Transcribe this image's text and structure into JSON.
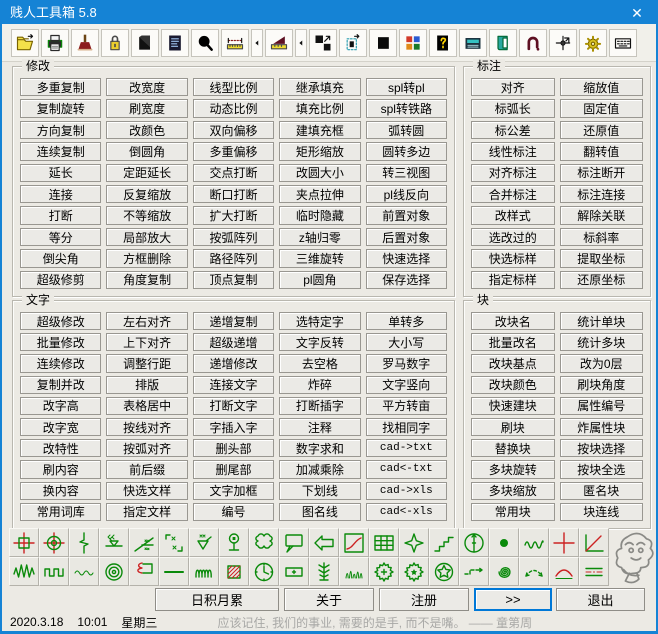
{
  "window": {
    "title": "贱人工具箱 5.8",
    "close_glyph": "✕"
  },
  "colors": {
    "titlebar": "#1583d5",
    "accent": "#0078d7",
    "icon_green": "#0a8a0a",
    "icon_red": "#cc2222"
  },
  "toolbar": {
    "buttons": [
      {
        "name": "open-file",
        "narrow": false
      },
      {
        "name": "printer",
        "narrow": false
      },
      {
        "name": "brush",
        "narrow": false
      },
      {
        "name": "lock",
        "narrow": false
      },
      {
        "name": "pages",
        "narrow": false
      },
      {
        "name": "document-list",
        "narrow": false
      },
      {
        "name": "magnifier",
        "narrow": false
      },
      {
        "name": "ruler",
        "narrow": false
      },
      {
        "name": "flyout-arrow",
        "narrow": true
      },
      {
        "name": "slope-ruler",
        "narrow": false
      },
      {
        "name": "flyout-arrow",
        "narrow": true
      },
      {
        "name": "scale-objects",
        "narrow": false
      },
      {
        "name": "dotted-selection",
        "narrow": false
      },
      {
        "name": "solid-square",
        "narrow": false
      },
      {
        "name": "color-grid",
        "narrow": false
      },
      {
        "name": "help-doc",
        "narrow": false
      },
      {
        "name": "calculator",
        "narrow": false
      },
      {
        "name": "notepad",
        "narrow": false
      },
      {
        "name": "magnet",
        "narrow": false
      },
      {
        "name": "crosshair-move",
        "narrow": false
      },
      {
        "name": "gear",
        "narrow": false
      },
      {
        "name": "keyboard",
        "narrow": false
      }
    ]
  },
  "groups": [
    {
      "id": "modify",
      "label": "修改",
      "columns": [
        [
          "多重复制",
          "复制旋转",
          "方向复制",
          "连续复制",
          "延长",
          "连接",
          "打断",
          "等分",
          "倒尖角",
          "超级修剪"
        ],
        [
          "改宽度",
          "刷宽度",
          "改颜色",
          "倒圆角",
          "定距延长",
          "反复缩放",
          "不等缩放",
          "局部放大",
          "方框删除",
          "角度复制"
        ],
        [
          "线型比例",
          "动态比例",
          "双向偏移",
          "多重偏移",
          "交点打断",
          "断口打断",
          "扩大打断",
          "按弧阵列",
          "路径阵列",
          "顶点复制"
        ],
        [
          "继承填充",
          "填充比例",
          "建填充框",
          "矩形缩放",
          "改圆大小",
          "夹点拉伸",
          "临时隐藏",
          "z轴归零",
          "三维旋转",
          "pl圆角"
        ],
        [
          "spl转pl",
          "spl转铁路",
          "弧转圆",
          "圆转多边",
          "转三视图",
          "pl线反向",
          "前置对象",
          "后置对象",
          "快速选择",
          "保存选择"
        ]
      ]
    },
    {
      "id": "dimension",
      "label": "标注",
      "columns": [
        [
          "对齐",
          "标弧长",
          "标公差",
          "线性标注",
          "对齐标注",
          "合并标注",
          "改样式",
          "选改过的",
          "快选标样",
          "指定标样"
        ],
        [
          "缩放值",
          "固定值",
          "还原值",
          "翻转值",
          "标注断开",
          "标注连接",
          "解除关联",
          "标斜率",
          "提取坐标",
          "还原坐标"
        ]
      ]
    },
    {
      "id": "text",
      "label": "文字",
      "columns": [
        [
          "超级修改",
          "批量修改",
          "连续修改",
          "复制并改",
          "改字高",
          "改字宽",
          "改特性",
          "刷内容",
          "换内容",
          "常用词库"
        ],
        [
          "左右对齐",
          "上下对齐",
          "调整行距",
          "排版",
          "表格居中",
          "按线对齐",
          "按弧对齐",
          "前后缀",
          "快选文样",
          "指定文样"
        ],
        [
          "递增复制",
          "超级递增",
          "递增修改",
          "连接文字",
          "打断文字",
          "字插入字",
          "删头部",
          "删尾部",
          "文字加框",
          "编号"
        ],
        [
          "选特定字",
          "文字反转",
          "去空格",
          "炸碎",
          "打断插字",
          "注释",
          "数字求和",
          "加减乘除",
          "下划线",
          "图名线"
        ],
        [
          "单转多",
          "大小写",
          "罗马数字",
          "文字竖向",
          "平方转亩",
          "找相同字",
          "cad->txt",
          "cad<-txt",
          "cad->xls",
          "cad<-xls"
        ]
      ]
    },
    {
      "id": "block",
      "label": "块",
      "columns": [
        [
          "改块名",
          "批量改名",
          "改块基点",
          "改块颜色",
          "快速建块",
          "刷块",
          "替换块",
          "多块旋转",
          "多块缩放",
          "常用块"
        ],
        [
          "统计单块",
          "统计多块",
          "改为0层",
          "刷块角度",
          "属性编号",
          "炸属性块",
          "按块选择",
          "按块全选",
          "匿名块",
          "块连线"
        ]
      ]
    }
  ],
  "icon_panel": {
    "rows": [
      [
        "axis-square",
        "axis-circle",
        "break-symbol",
        "elevation-mark",
        "slope-mark",
        "corner-marks",
        "check-triangle",
        "lamp-post",
        "revision-cloud",
        "callout-bubble",
        "hollow-arrow",
        "curve-chart",
        "table-grid",
        "four-point-star",
        "stairs",
        "section-circle",
        "solid-dot",
        "small-coil",
        "red-cross",
        "axis-diagonal"
      ],
      [
        "zigzag-wave",
        "square-wave",
        "small-wave",
        "concentric-rings",
        "brace-leader",
        "single-line",
        "spring-coil",
        "hatched-box",
        "clock",
        "labeled-box",
        "plant-symbol",
        "grass-marks",
        "gear-plus",
        "gear-star",
        "circled-star",
        "dashed-step-arrow",
        "spiral",
        "dotted-arc",
        "red-arch",
        "centerline-pair"
      ]
    ]
  },
  "footer": {
    "buttons": [
      {
        "label": "日积月累",
        "focused": false
      },
      {
        "label": "关于",
        "focused": false
      },
      {
        "label": "注册",
        "focused": false
      },
      {
        "label": ">>",
        "focused": true
      },
      {
        "label": "退出",
        "focused": false
      }
    ]
  },
  "statusbar": {
    "date": "2020.3.18",
    "time": "10:01",
    "weekday": "星期三",
    "quote": "应该记住, 我们的事业, 需要的是手, 而不是嘴。 —— 童第周"
  }
}
